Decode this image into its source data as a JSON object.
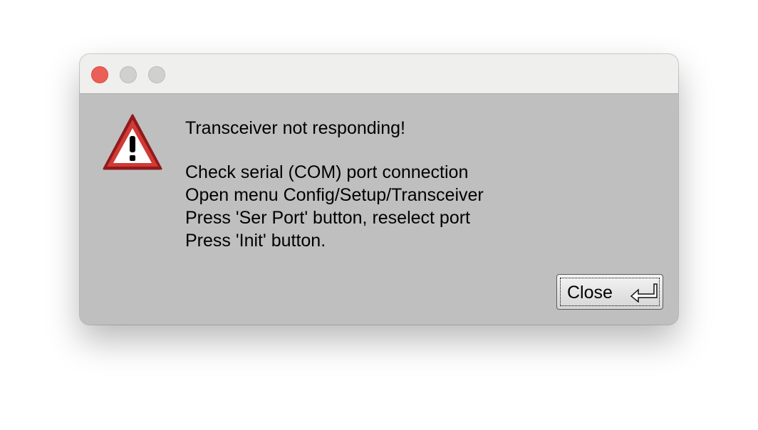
{
  "window": {
    "controls": [
      "close",
      "minimize",
      "zoom"
    ]
  },
  "dialog": {
    "icon": "warning-icon",
    "lines": [
      "Transceiver not responding!",
      "Check serial (COM) port connection",
      "Open menu Config/Setup/Transceiver",
      "Press 'Ser Port' button, reselect port",
      "Press 'Init' button."
    ],
    "close_label": "Close",
    "close_icon": "return-key-icon"
  },
  "colors": {
    "accent_close": "#ec5f57",
    "warning_red": "#c0262a",
    "dialog_bg": "#bfbfbf"
  }
}
